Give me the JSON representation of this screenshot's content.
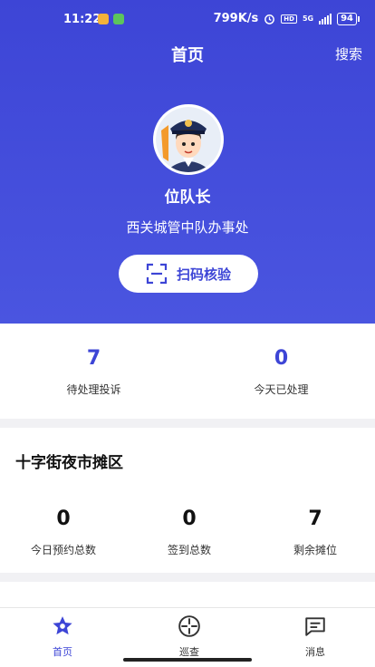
{
  "status": {
    "time": "11:22",
    "speed": "799K/s",
    "hd": "HD",
    "network": "5G",
    "battery": "94"
  },
  "nav": {
    "title": "首页",
    "search": "搜索"
  },
  "profile": {
    "name": "位队长",
    "org": "西关城管中队办事处",
    "scan_label": "扫码核验"
  },
  "summary": [
    {
      "value": "7",
      "label": "待处理投诉"
    },
    {
      "value": "0",
      "label": "今天已处理"
    }
  ],
  "market": {
    "title": "十字街夜市摊区",
    "stats": [
      {
        "value": "0",
        "label": "今日预约总数"
      },
      {
        "value": "0",
        "label": "签到总数"
      },
      {
        "value": "7",
        "label": "剩余摊位"
      }
    ]
  },
  "tabs": [
    {
      "label": "首页",
      "icon": "star-icon"
    },
    {
      "label": "巡查",
      "icon": "patrol-icon"
    },
    {
      "label": "消息",
      "icon": "message-icon"
    }
  ],
  "colors": {
    "primary": "#3d45d6"
  }
}
